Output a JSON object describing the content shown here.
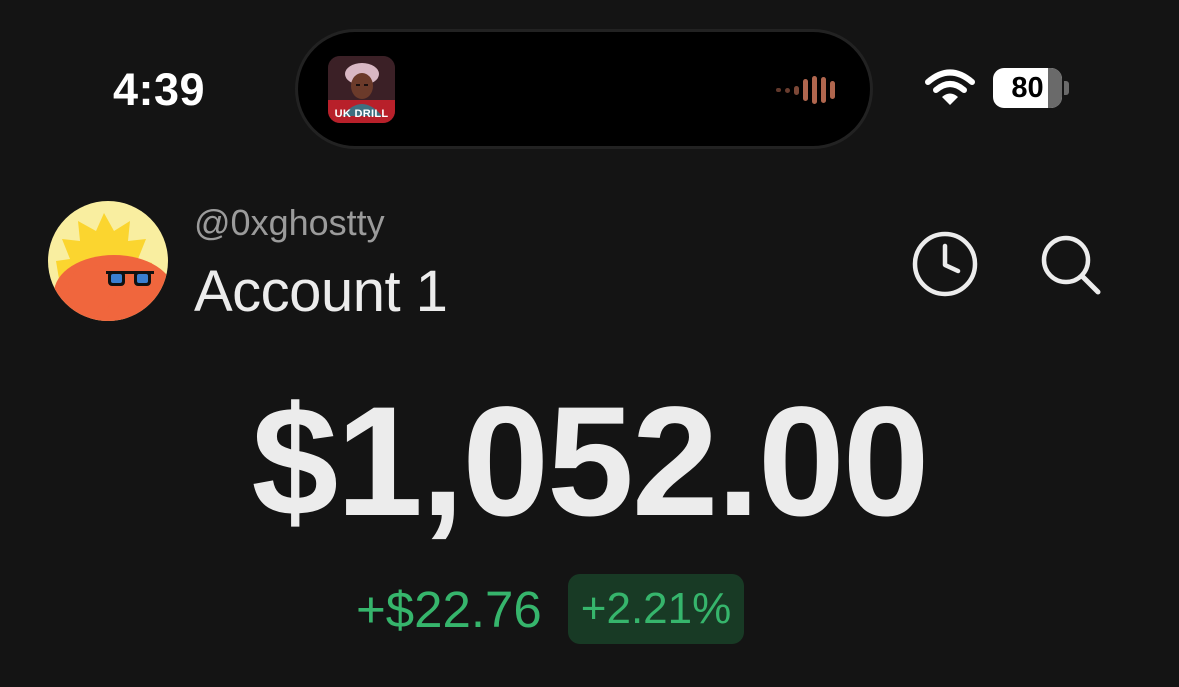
{
  "status_bar": {
    "time": "4:39",
    "now_playing": {
      "artwork_caption": "UK DRILL",
      "waveform_icon": "audio-waveform-icon"
    },
    "wifi_icon": "wifi-icon",
    "battery": {
      "level_percent": 80,
      "label": "80"
    }
  },
  "account": {
    "avatar_icon": "sunglasses-avatar",
    "username": "@0xghostty",
    "name": "Account 1",
    "actions": {
      "history_icon": "clock-icon",
      "search_icon": "search-icon"
    }
  },
  "balance": {
    "total": "$1,052.00",
    "change_amount": "+$22.76",
    "change_percent": "+2.21%"
  },
  "colors": {
    "background": "#141414",
    "positive": "#36b56c",
    "positive_badge_bg": "#183a25",
    "muted_text": "#9b9b9b",
    "primary_text": "#ececec"
  }
}
